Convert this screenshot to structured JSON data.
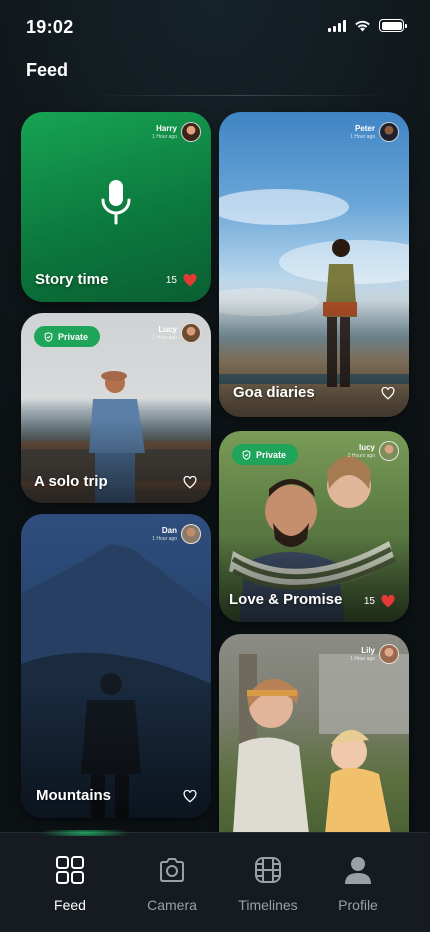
{
  "status_bar": {
    "time": "19:02"
  },
  "header": {
    "title": "Feed"
  },
  "cards": [
    {
      "title": "Story time",
      "author": "Harry",
      "posted": "1 Hour ago",
      "likes": "15",
      "private": false,
      "liked": true
    },
    {
      "title": "Goa diaries",
      "author": "Peter",
      "posted": "1 Hour ago",
      "likes": "",
      "private": false,
      "liked": false
    },
    {
      "title": "A solo trip",
      "author": "Lucy",
      "posted": "1 Hour ago",
      "likes": "",
      "private": true,
      "liked": false
    },
    {
      "title": "Love & Promise",
      "author": "lucy",
      "posted": "2 Hours ago",
      "likes": "15",
      "private": true,
      "liked": true
    },
    {
      "title": "Mountains",
      "author": "Dan",
      "posted": "1 Hour ago",
      "likes": "",
      "private": false,
      "liked": false
    },
    {
      "title": "",
      "author": "Lily",
      "posted": "1 Hour ago",
      "likes": "",
      "private": false,
      "liked": false
    }
  ],
  "private_label": "Private",
  "nav": [
    {
      "label": "Feed",
      "icon": "grid-icon",
      "active": true
    },
    {
      "label": "Camera",
      "icon": "camera-icon",
      "active": false
    },
    {
      "label": "Timelines",
      "icon": "film-icon",
      "active": false
    },
    {
      "label": "Profile",
      "icon": "person-icon",
      "active": false
    }
  ],
  "colors": {
    "accent": "#1fa55a",
    "heart": "#e53935",
    "background": "#0f1418"
  }
}
